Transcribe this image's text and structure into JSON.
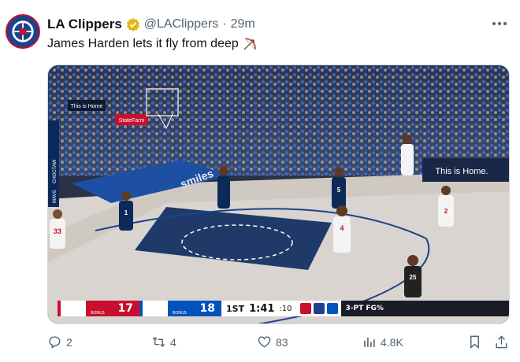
{
  "author": {
    "display_name": "LA Clippers",
    "handle": "@LAClippers",
    "separator": "·",
    "time": "29m",
    "avatar_text": "LOS ANGELES CLIPPERS",
    "verified_color": "#e2b719"
  },
  "tweet": {
    "text": "James Harden lets it fly from deep",
    "emoji": "bow-and-arrow-icon"
  },
  "media": {
    "scoreboard": {
      "team1_score": "17",
      "team1_bonus": "BONUS",
      "team2_score": "18",
      "team2_bonus": "BONUS",
      "quarter": "1ST",
      "clock": "1:41",
      "shot_clock": ":10",
      "stat_label": "3-PT FG%"
    },
    "signs": {
      "this_is_home_left": "This is Home",
      "this_is_home_right": "This is Home.",
      "state_farm": "StateFarm",
      "court_brand": "smiles",
      "choctaw": "CHOCTAW",
      "mavs": "MAVS"
    },
    "jerseys": [
      "33",
      "1",
      "5",
      "4",
      "2",
      "25"
    ]
  },
  "actions": {
    "replies": "2",
    "reposts": "4",
    "likes": "83",
    "views": "4.8K"
  },
  "colors": {
    "clippers_red": "#c8102e",
    "clippers_blue": "#1d428a",
    "mavs_blue": "#0053bc",
    "text_secondary": "#536471"
  }
}
